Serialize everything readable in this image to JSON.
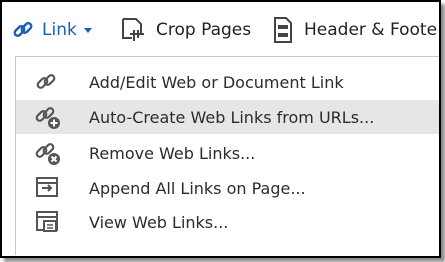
{
  "toolbar": {
    "link_label": "Link",
    "crop_label": "Crop Pages",
    "header_label": "Header & Foote"
  },
  "menu": {
    "items": [
      {
        "label": "Add/Edit Web or Document Link",
        "icon": "link-edit-icon"
      },
      {
        "label": "Auto-Create Web Links from URLs...",
        "icon": "link-add-icon",
        "highlighted": true
      },
      {
        "label": "Remove Web Links...",
        "icon": "link-remove-icon"
      },
      {
        "label": "Append All Links on Page...",
        "icon": "append-links-icon"
      },
      {
        "label": "View Web Links...",
        "icon": "view-links-icon"
      }
    ]
  },
  "colors": {
    "accent": "#1a5fb4",
    "highlight": "#e6e6e6",
    "icon": "#555555"
  }
}
